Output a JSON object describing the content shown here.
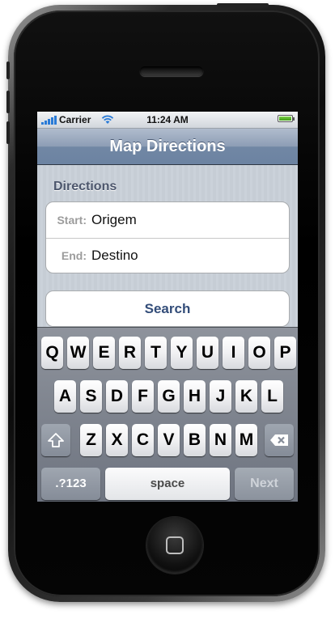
{
  "status_bar": {
    "carrier": "Carrier",
    "time": "11:24 AM"
  },
  "nav": {
    "title": "Map Directions"
  },
  "form": {
    "section_header": "Directions",
    "start_label": "Start:",
    "start_value": "Origem",
    "end_label": "End:",
    "end_value": "Destino",
    "search_label": "Search"
  },
  "keyboard": {
    "row1": [
      "Q",
      "W",
      "E",
      "R",
      "T",
      "Y",
      "U",
      "I",
      "O",
      "P"
    ],
    "row2": [
      "A",
      "S",
      "D",
      "F",
      "G",
      "H",
      "J",
      "K",
      "L"
    ],
    "row3": [
      "Z",
      "X",
      "C",
      "V",
      "B",
      "N",
      "M"
    ],
    "mode_label": ".?123",
    "space_label": "space",
    "next_label": "Next"
  },
  "colors": {
    "nav_bar": "#6c83a2",
    "button_text": "#334d79",
    "section_header": "#4c566c"
  }
}
